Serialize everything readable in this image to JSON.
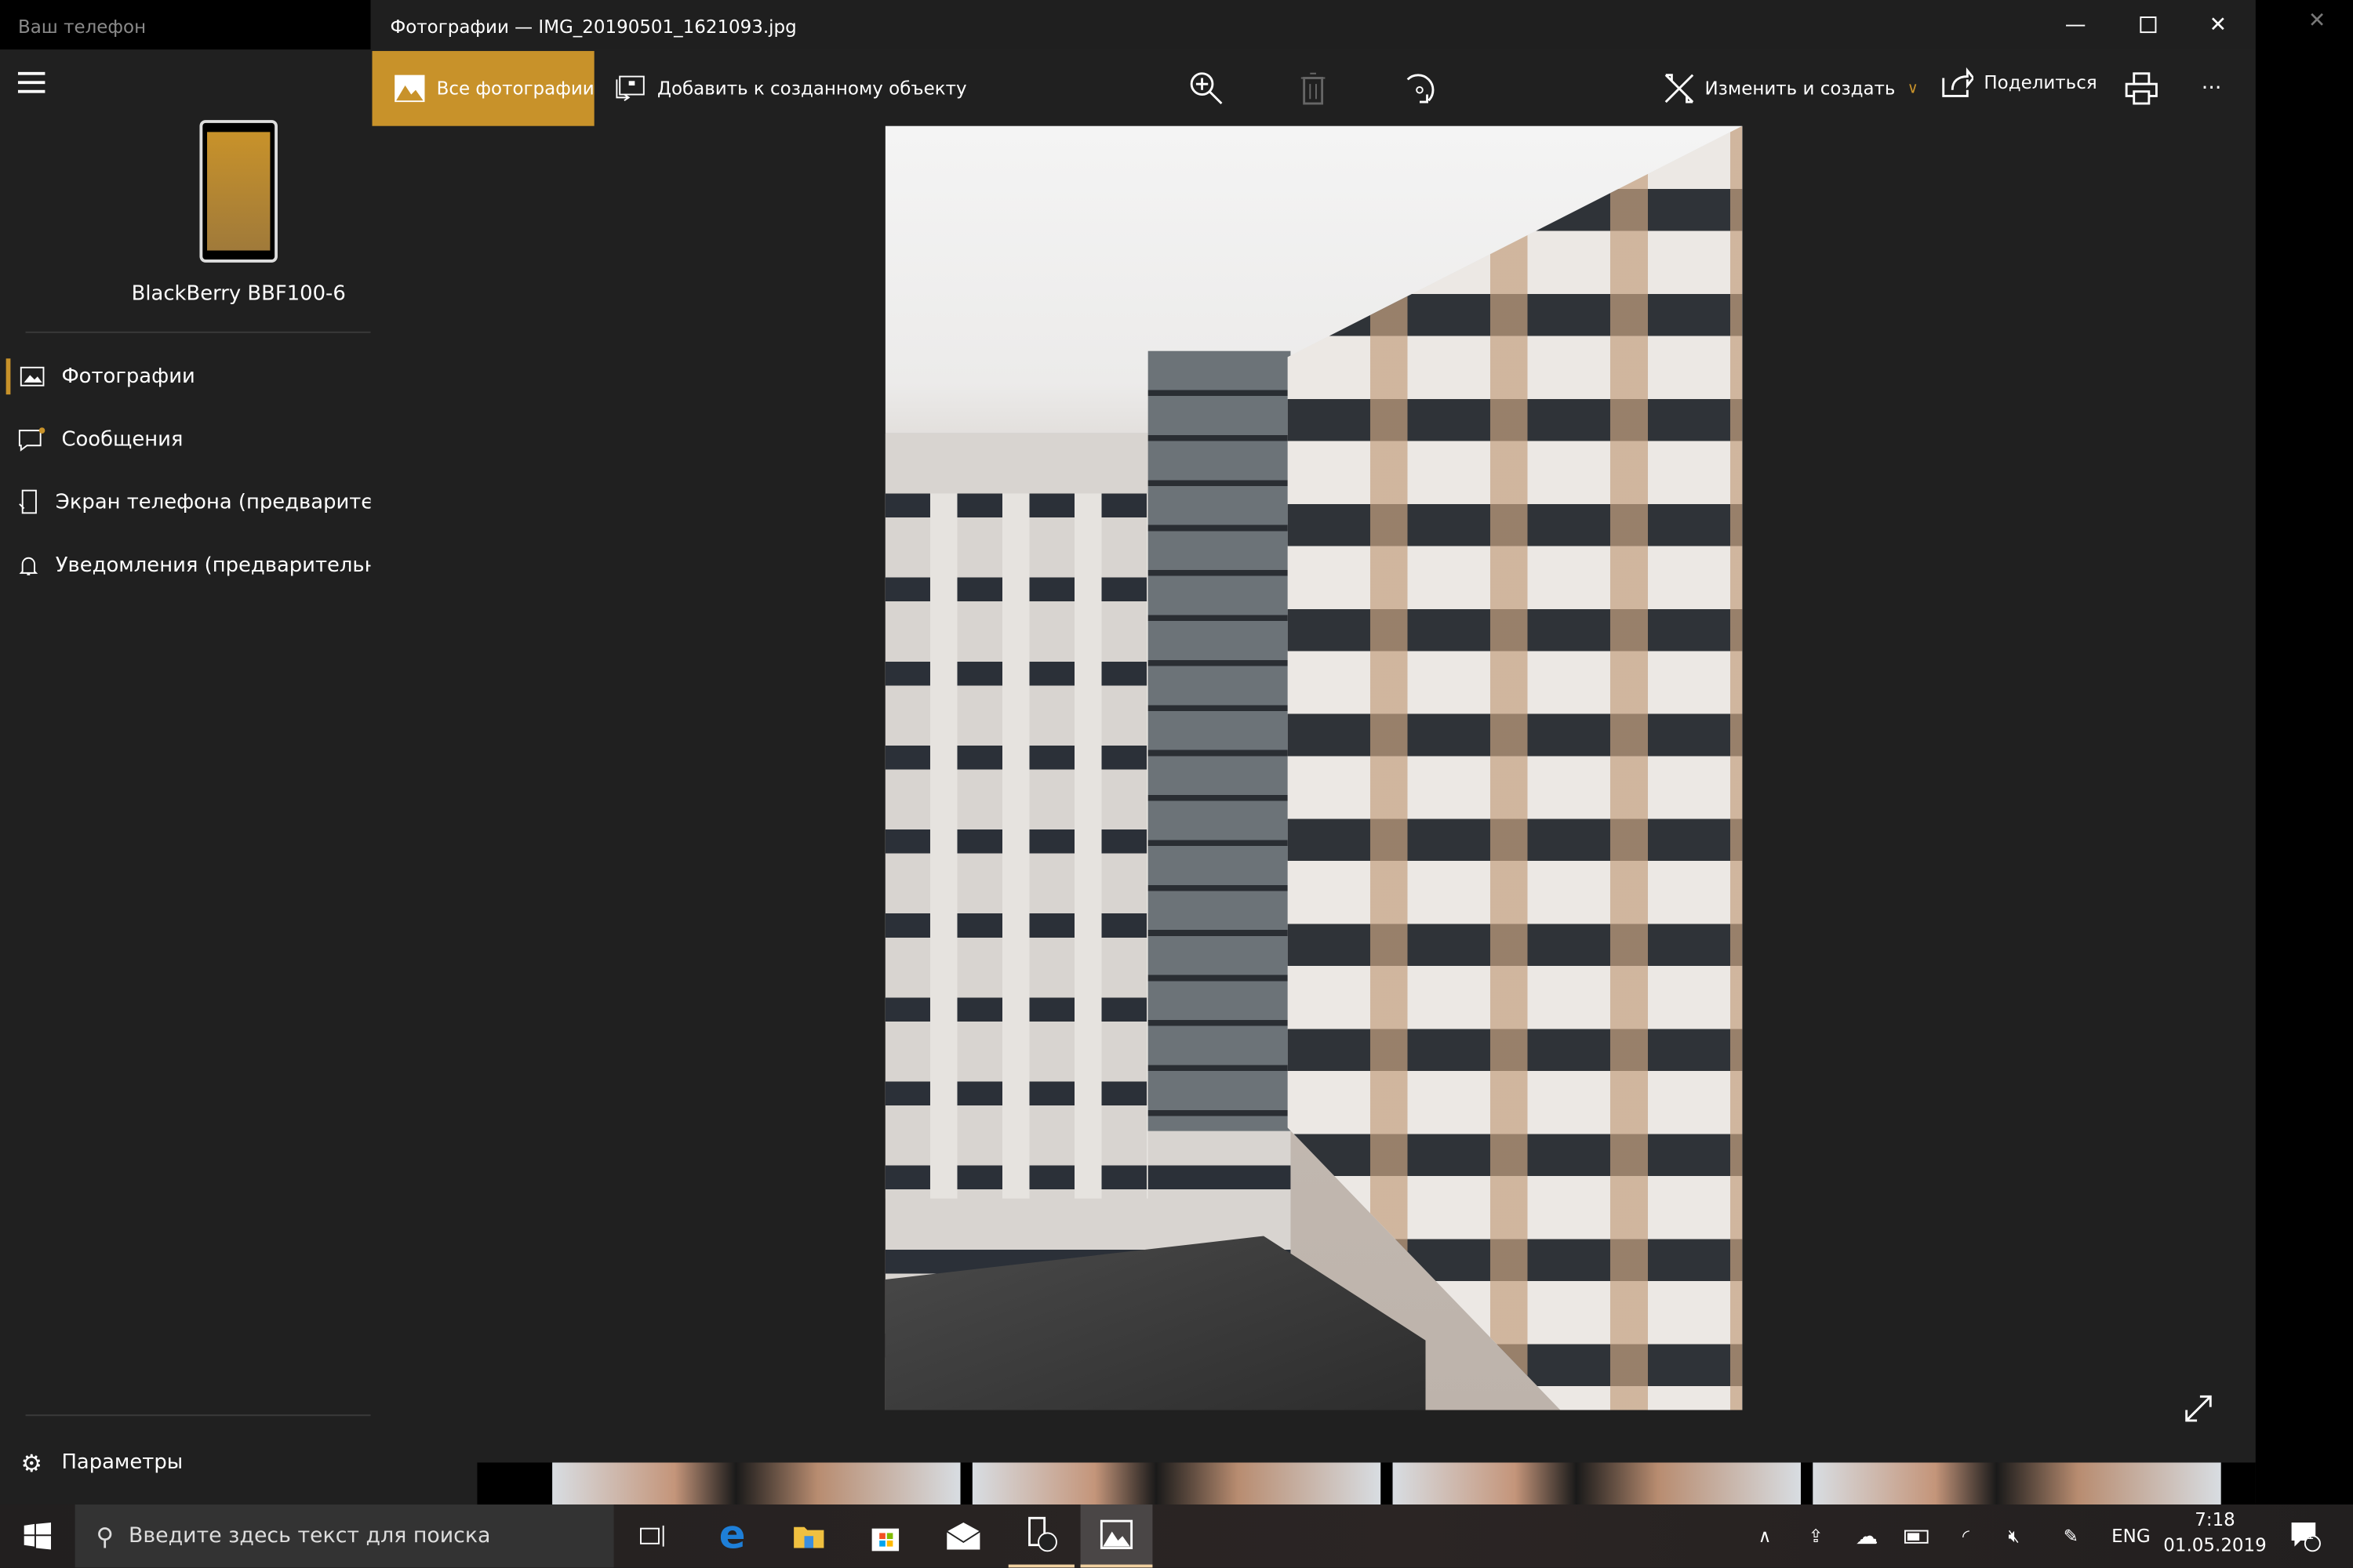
{
  "phone_app": {
    "title": "Ваш телефон",
    "device_name": "BlackBerry BBF100-6",
    "nav": [
      {
        "label": "Фотографии",
        "icon": "photo-icon",
        "selected": true
      },
      {
        "label": "Сообщения",
        "icon": "message-icon"
      },
      {
        "label": "Экран телефона (предварительная версия)",
        "icon": "phone-screen-icon"
      },
      {
        "label": "Уведомления (предварительная версия)",
        "icon": "bell-icon"
      }
    ],
    "settings_label": "Параметры"
  },
  "photos_window": {
    "title": "Фотографии — IMG_20190501_1621093.jpg",
    "toolbar": {
      "all_photos": "Все фотографии",
      "add_to_creation": "Добавить к созданному объекту",
      "edit_create": "Изменить и создать",
      "share": "Поделиться",
      "more": "···"
    }
  },
  "taskbar": {
    "search_placeholder": "Введите здесь текст для поиска",
    "language": "ENG",
    "time": "7:18",
    "date": "01.05.2019",
    "notification_count": "1"
  },
  "colors": {
    "accent": "#c8922a",
    "background": "#202020"
  }
}
